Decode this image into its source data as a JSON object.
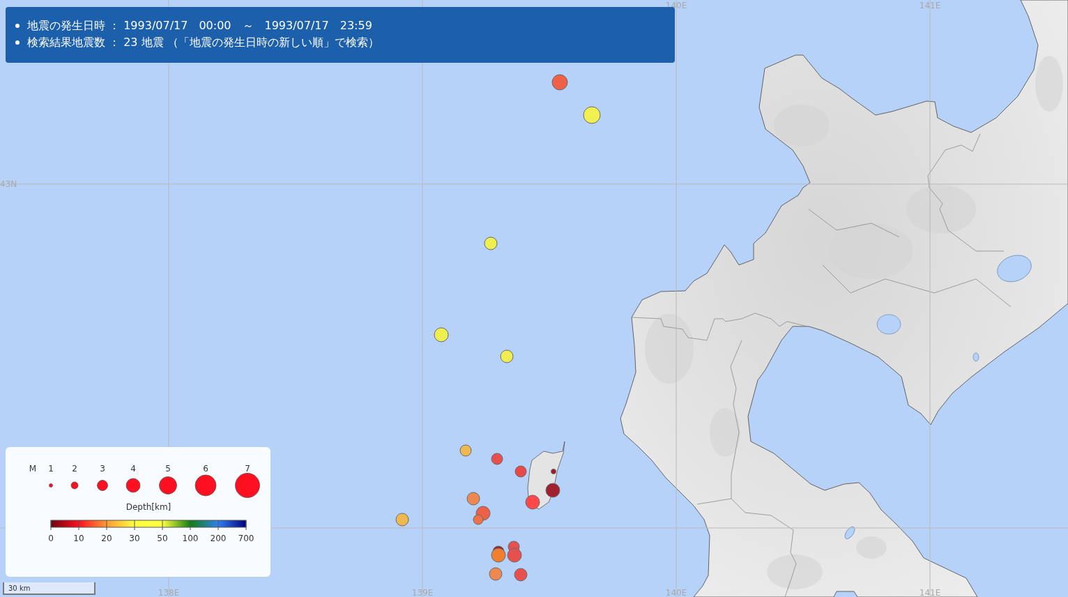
{
  "header": {
    "items": [
      "地震の発生日時 ： 1993/07/17　00:00　～　1993/07/17　23:59",
      "検索結果地震数 ： 23 地震 （「地震の発生日時の新しい順」で検索）"
    ]
  },
  "map": {
    "grid_labels": [
      "140E",
      "141E",
      "43N",
      "138E",
      "139E",
      "140E",
      "141E"
    ],
    "earthquakes": [
      {
        "color": "#ee6048"
      },
      {
        "color": "#f0f050"
      },
      {
        "color": "#eef050"
      },
      {
        "color": "#eef050"
      },
      {
        "color": "#eeee50"
      },
      {
        "color": "#f0b850"
      },
      {
        "color": "#e85050"
      },
      {
        "color": "#e84848"
      },
      {
        "color": "#a01828"
      },
      {
        "color": "#a02030"
      },
      {
        "color": "#ff4848"
      },
      {
        "color": "#ee8850"
      },
      {
        "color": "#ee6048"
      },
      {
        "color": "#ee7048"
      },
      {
        "color": "#f0b850"
      },
      {
        "color": "#e85050"
      },
      {
        "color": "#a02030"
      },
      {
        "color": "#f08030"
      },
      {
        "color": "#e85050"
      },
      {
        "color": "#ee8850"
      },
      {
        "color": "#e85050"
      }
    ]
  },
  "legend": {
    "magnitude_label": "M",
    "magnitudes": [
      "1",
      "2",
      "3",
      "4",
      "5",
      "6",
      "7"
    ],
    "depth_title": "Depth[km]",
    "depth_ticks": [
      "0",
      "10",
      "20",
      "30",
      "50",
      "100",
      "200",
      "700"
    ]
  },
  "scale_bar": {
    "label": "30 km"
  }
}
